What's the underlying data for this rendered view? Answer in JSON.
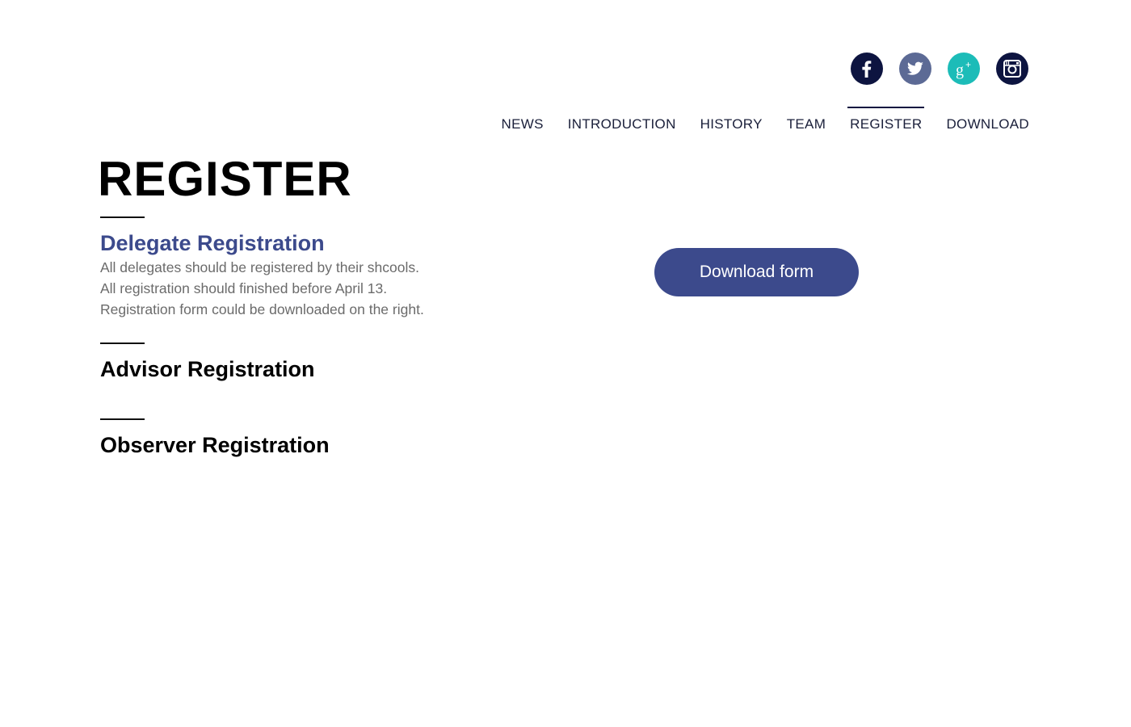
{
  "social": [
    {
      "name": "facebook",
      "icon": "facebook-icon",
      "color": "#0d1440"
    },
    {
      "name": "twitter",
      "icon": "twitter-icon",
      "color": "#5c6a95"
    },
    {
      "name": "google-plus",
      "icon": "google-plus-icon",
      "color": "#1cbcb8"
    },
    {
      "name": "instagram",
      "icon": "instagram-icon",
      "color": "#0d1440"
    }
  ],
  "nav": {
    "items": [
      {
        "label": "NEWS"
      },
      {
        "label": "INTRODUCTION"
      },
      {
        "label": "HISTORY"
      },
      {
        "label": "TEAM"
      },
      {
        "label": "REGISTER",
        "active": true
      },
      {
        "label": "DOWNLOAD"
      }
    ]
  },
  "main": {
    "title": "REGISTER",
    "sections": [
      {
        "heading": "Delegate Registration",
        "lines": [
          "All delegates should be registered by their shcools.",
          "All registration should finished before April 13.",
          "Registration form could be downloaded on the right."
        ]
      },
      {
        "heading": "Advisor Registration"
      },
      {
        "heading": "Observer Registration"
      }
    ],
    "download_button": "Download form"
  },
  "colors": {
    "accent": "#3c4a8c",
    "nav_text": "#1a1f3a",
    "body_text": "#6b6b6b"
  }
}
